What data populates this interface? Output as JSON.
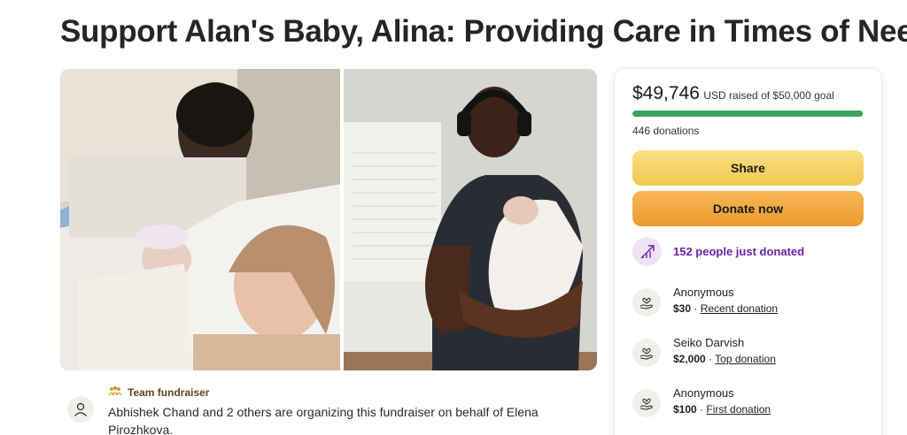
{
  "page": {
    "title": "Support Alan's Baby, Alina: Providing Care in Times of Need"
  },
  "organizer": {
    "tag": "Team fundraiser",
    "text": "Abhishek Chand and 2 others are organizing this fundraiser on behalf of Elena Pirozhkova."
  },
  "card": {
    "raised": "$49,746",
    "raised_suffix": "USD raised of $50,000 goal",
    "progress_fraction": 0.995,
    "donations": "446 donations",
    "share_label": "Share",
    "donate_label": "Donate now",
    "trend_text": "152 people just donated",
    "donors": [
      {
        "name": "Anonymous",
        "amount": "$30",
        "separator": " · ",
        "label": "Recent donation"
      },
      {
        "name": "Seiko Darvish",
        "amount": "$2,000",
        "separator": " · ",
        "label": "Top donation"
      },
      {
        "name": "Anonymous",
        "amount": "$100",
        "separator": " · ",
        "label": "First donation"
      }
    ]
  },
  "colors": {
    "progress": "#3aa35f",
    "trend": "#6b21a8",
    "share": "#f2c84f",
    "donate": "#ee9a2f"
  },
  "icons": {
    "organizer": "user-icon",
    "team": "team-icon",
    "trend": "trending-up-icon",
    "donor": "heart-hand-icon"
  }
}
